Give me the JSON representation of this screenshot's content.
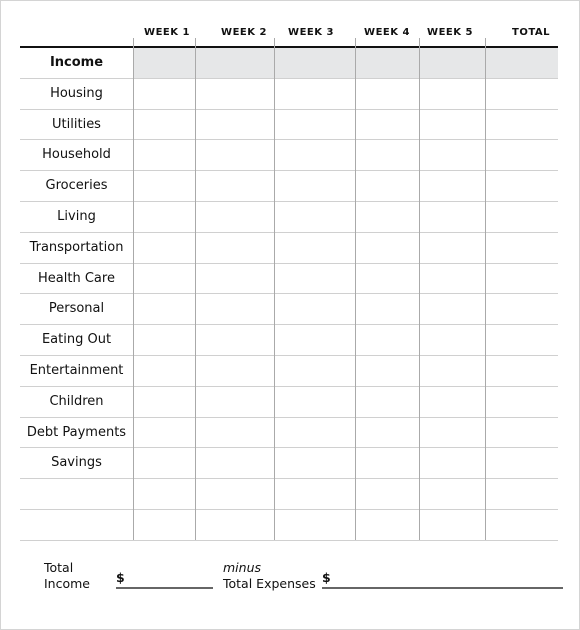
{
  "columns": [
    "WEEK 1",
    "WEEK 2",
    "WEEK 3",
    "WEEK 4",
    "WEEK 5",
    "TOTAL"
  ],
  "rows": [
    "Income",
    "Housing",
    "Utilities",
    "Household",
    "Groceries",
    "Living",
    "Transportation",
    "Health Care",
    "Personal",
    "Eating Out",
    "Entertainment",
    "Children",
    "Debt Payments",
    "Savings",
    "",
    ""
  ],
  "footer": {
    "total_income_line1": "Total",
    "total_income_line2": "Income",
    "dollar1": "$",
    "minus": "minus",
    "total_expenses": "Total Expenses",
    "dollar2": "$"
  },
  "colors": {
    "shade": "#e6e7e8",
    "rule": "#111111"
  }
}
